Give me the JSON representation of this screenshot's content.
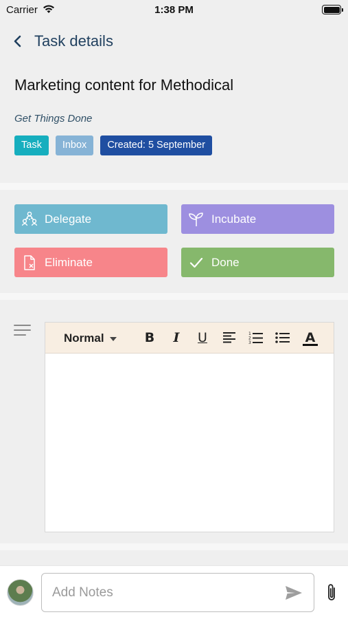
{
  "status_bar": {
    "carrier": "Carrier",
    "time": "1:38 PM"
  },
  "header": {
    "title": "Task details",
    "back_icon": "chevron-left-icon"
  },
  "task": {
    "title": "Marketing content for Methodical",
    "project": "Get Things Done",
    "tags": [
      {
        "label": "Task",
        "color": "#16aebe"
      },
      {
        "label": "Inbox",
        "color": "#86b3d6"
      },
      {
        "label": "Created: 5 September",
        "color": "#1f4ea1"
      }
    ]
  },
  "actions": {
    "delegate": {
      "label": "Delegate",
      "icon": "people-hierarchy-icon",
      "color": "#6fb8cf"
    },
    "incubate": {
      "label": "Incubate",
      "icon": "sprout-icon",
      "color": "#9d8fe0"
    },
    "eliminate": {
      "label": "Eliminate",
      "icon": "file-x-icon",
      "color": "#f7858a"
    },
    "done": {
      "label": "Done",
      "icon": "checkmark-icon",
      "color": "#86b86c"
    }
  },
  "editor": {
    "format": "Normal",
    "buttons": {
      "bold": "B",
      "italic": "I",
      "underline": "U",
      "text_color": "A"
    }
  },
  "footer": {
    "notes_placeholder": "Add Notes"
  }
}
